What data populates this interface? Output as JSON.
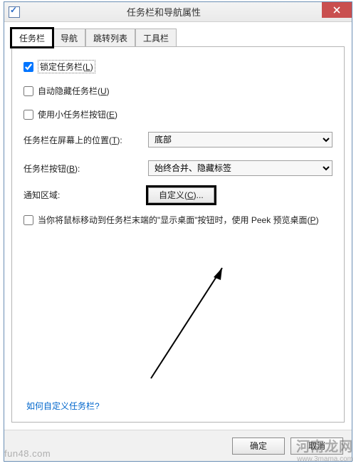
{
  "window": {
    "title": "任务栏和导航属性"
  },
  "tabs": {
    "t0": "任务栏",
    "t1": "导航",
    "t2": "跳转列表",
    "t3": "工具栏"
  },
  "checkboxes": {
    "lock": {
      "label_pre": "锁定任务栏(",
      "key": "L",
      "label_post": ")",
      "checked": true
    },
    "autohide": {
      "label_pre": "自动隐藏任务栏(",
      "key": "U",
      "label_post": ")",
      "checked": false
    },
    "small": {
      "label_pre": "使用小任务栏按钮(",
      "key": "E",
      "label_post": ")",
      "checked": false
    },
    "peek": {
      "label_pre": "当你将鼠标移动到任务栏末端的\"显示桌面\"按钮时，使用 Peek 预览桌面(",
      "key": "P",
      "label_post": ")",
      "checked": false
    }
  },
  "rows": {
    "position": {
      "label_pre": "任务栏在屏幕上的位置(",
      "key": "T",
      "label_post": "):",
      "value": "底部"
    },
    "buttons": {
      "label_pre": "任务栏按钮(",
      "key": "B",
      "label_post": "):",
      "value": "始终合并、隐藏标签"
    },
    "notify": {
      "label": "通知区域:",
      "button_pre": "自定义(",
      "key": "C",
      "post": ")..."
    }
  },
  "help_link": "如何自定义任务栏?",
  "footer": {
    "ok": "确定",
    "cancel": "取消"
  },
  "watermarks": {
    "left": "fun48.com",
    "right_main": "河南龙网",
    "right_sub": "www.3mama.com"
  }
}
